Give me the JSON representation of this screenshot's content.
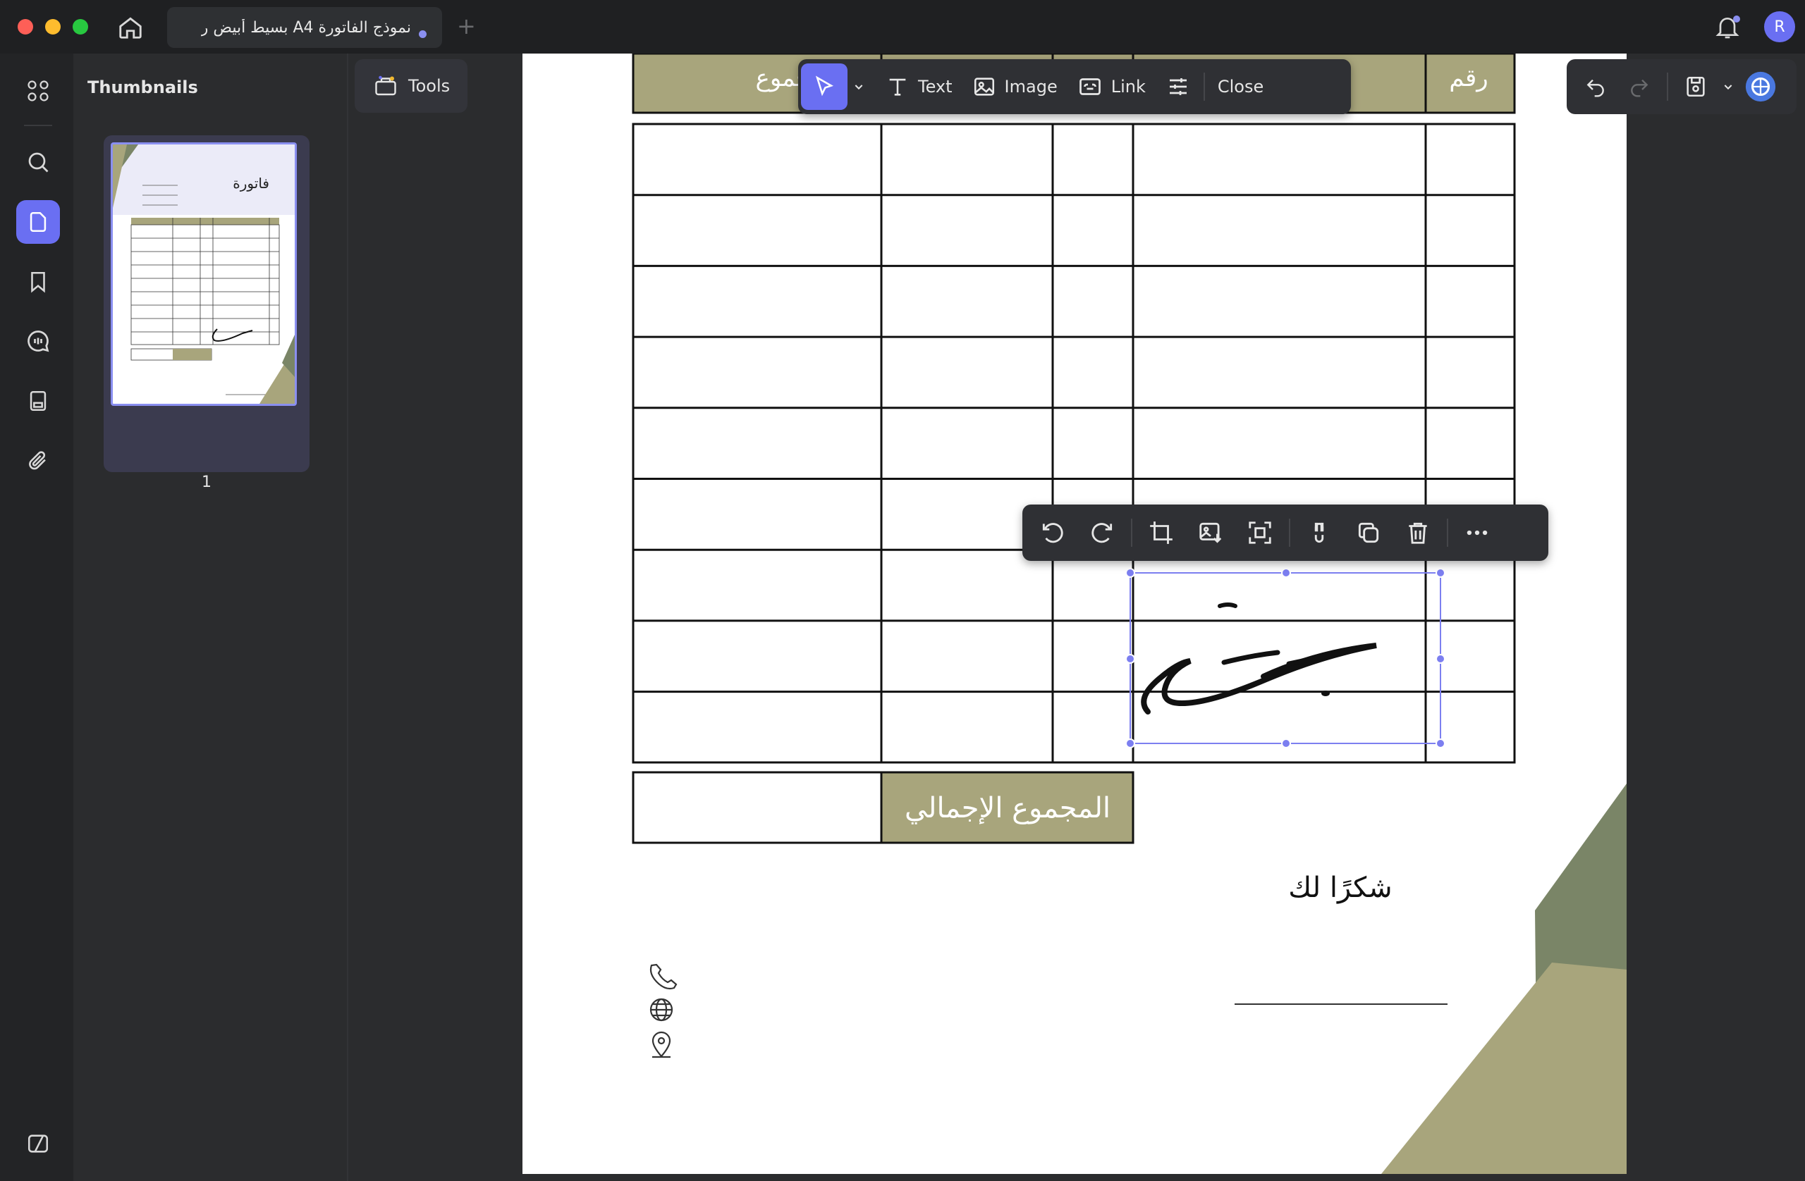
{
  "tab": {
    "title": "نموذج الفاتورة A4 بسيط أبيض ر"
  },
  "user": {
    "initial": "R"
  },
  "sidebar": {
    "title": "Thumbnails",
    "page_number": "1",
    "thumb_title": "فاتورة"
  },
  "tools": {
    "label": "Tools"
  },
  "edit_toolbar": {
    "text_label": "Text",
    "image_label": "Image",
    "link_label": "Link",
    "close_label": "Close"
  },
  "document": {
    "header_total": "المجموع",
    "header_number": "رقم",
    "grand_total_label": "المجموع الإجمالي",
    "thanks": "شكرًا لك"
  },
  "colors": {
    "accent": "#6a6ff2",
    "olive": "#a8a57c",
    "green_dark": "#7a8567"
  }
}
